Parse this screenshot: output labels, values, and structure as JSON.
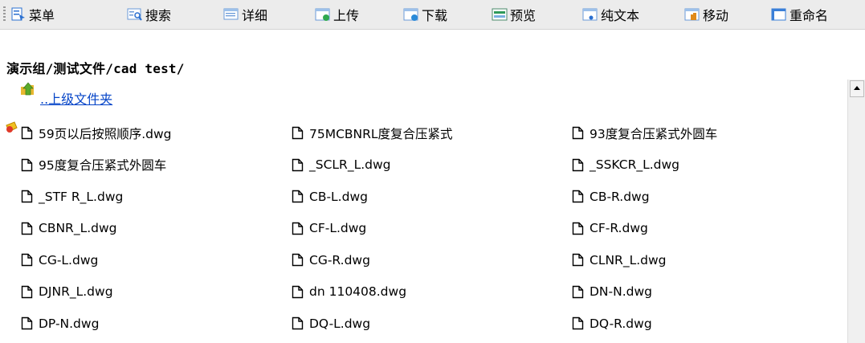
{
  "toolbar": {
    "buttons": [
      {
        "label": "菜单",
        "icon": "menu-icon",
        "color": "#2a6fd0"
      },
      {
        "label": "搜索",
        "icon": "search-icon",
        "color": "#3a7fd8"
      },
      {
        "label": "详细",
        "icon": "details-icon",
        "color": "#6a9ad8"
      },
      {
        "label": "上传",
        "icon": "upload-icon",
        "color": "#2fa84f"
      },
      {
        "label": "下载",
        "icon": "download-icon",
        "color": "#2a8ad8"
      },
      {
        "label": "预览",
        "icon": "preview-icon",
        "color": "#2f9a5a"
      },
      {
        "label": "纯文本",
        "icon": "plaintext-icon",
        "color": "#3a7fd8"
      },
      {
        "label": "移动",
        "icon": "move-icon",
        "color": "#e08a1a"
      },
      {
        "label": "重命名",
        "icon": "rename-icon",
        "color": "#3a7fd8"
      }
    ]
  },
  "breadcrumb": "演示组/测试文件/cad test/",
  "parent_folder": "..上级文件夹",
  "files": [
    "59页以后按照顺序.dwg",
    "75MCBNRL度复合压紧式",
    "93度复合压紧式外圆车",
    "95度复合压紧式外圆车",
    "_SCLR_L.dwg",
    "_SSKCR_L.dwg",
    "_STF R_L.dwg",
    "CB-L.dwg",
    "CB-R.dwg",
    "CBNR_L.dwg",
    "CF-L.dwg",
    "CF-R.dwg",
    "CG-L.dwg",
    "CG-R.dwg",
    "CLNR_L.dwg",
    "DJNR_L.dwg",
    "dn 110408.dwg",
    "DN-N.dwg",
    "DP-N.dwg",
    "DQ-L.dwg",
    "DQ-R.dwg"
  ]
}
